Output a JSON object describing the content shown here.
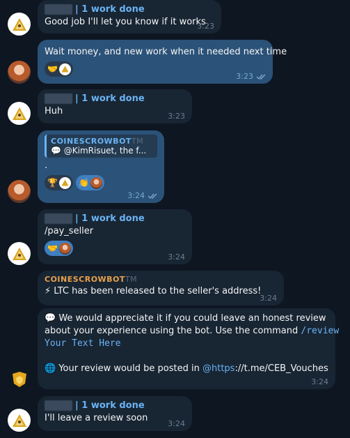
{
  "messages": [
    {
      "sender": "| 1 work done",
      "text": "Good job I'll let you know if it works",
      "time": "3:23"
    },
    {
      "text": "Wait money, and new work when it needed next time",
      "time": "3:23",
      "reactions": [
        "🤝"
      ]
    },
    {
      "sender": "| 1 work done",
      "text": "Huh",
      "time": "3:23"
    },
    {
      "quote_name": "COINESCROWBOT",
      "quote_tm": "TM",
      "quote_text": "💬 @KimRisuet, the f...",
      "text": ".",
      "time": "3:24",
      "reactions": [
        "🏆",
        "👏"
      ]
    },
    {
      "sender": "| 1 work done",
      "text": "/pay_seller",
      "time": "3:24",
      "reactions": [
        "🤝"
      ]
    },
    {
      "bot_name": "COINESCROWBOT",
      "bot_tm": "TM",
      "text": "⚡ LTC has been released to the seller's address!",
      "time": "3:24"
    },
    {
      "line1": "💬 We would appreciate it if you could leave an honest review",
      "line2": "about your experience using the bot. Use the command",
      "command": "/review",
      "line3": "Your Text Here",
      "line4_a": "🌐 Your review would be posted in",
      "line4_link": "@https",
      "line4_b": "://t.me/CEB_Vouches",
      "time": "3:24"
    },
    {
      "sender": "| 1 work done",
      "text": "I'll leave a review soon",
      "time": "3:24"
    }
  ],
  "colors": {
    "background": "#0e1621",
    "incoming": "#182533",
    "outgoing": "#2b5278",
    "accent": "#6ab3f3",
    "bot_name": "#e8a14b"
  },
  "icons": {
    "read_receipt": "double-check-icon",
    "pyramid_avatar": "pyramid-avatar",
    "woman_avatar": "user-avatar",
    "gold_avatar": "bot-avatar"
  }
}
